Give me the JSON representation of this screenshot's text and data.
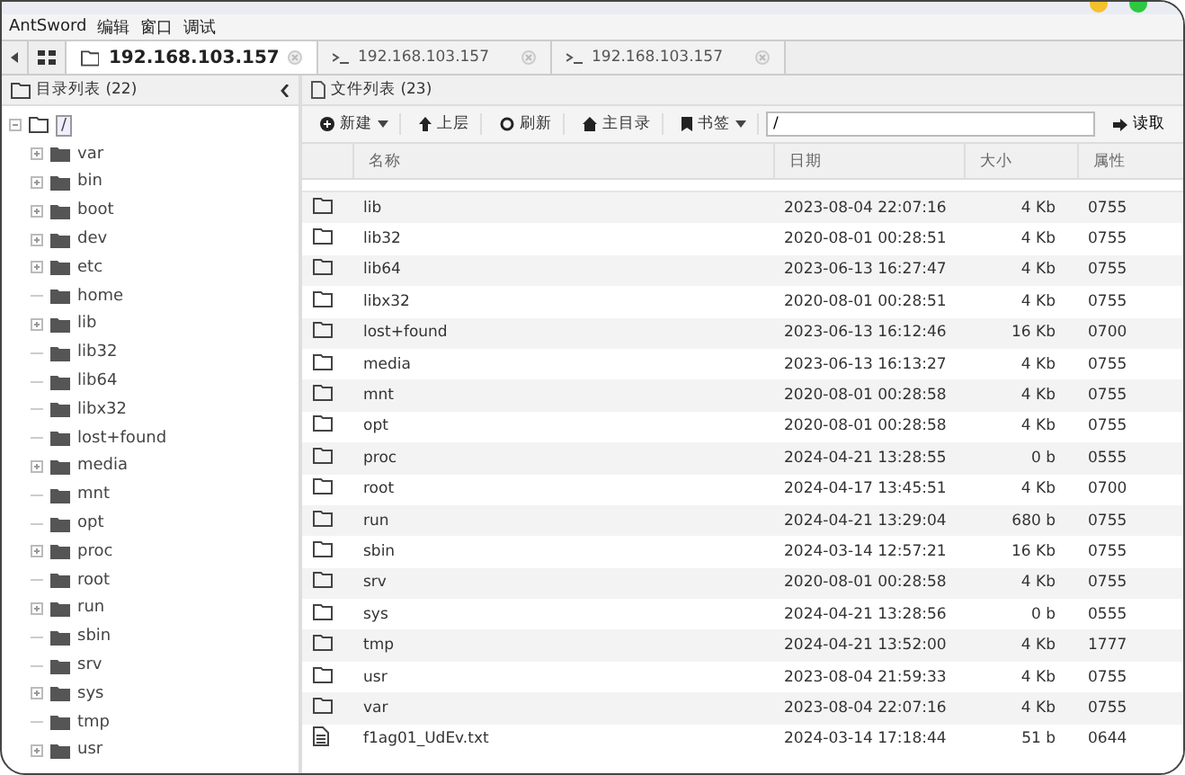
{
  "menu": [
    "AntSword",
    "编辑",
    "窗口",
    "调试"
  ],
  "tabs": [
    {
      "label": "192.168.103.157",
      "kind": "folder",
      "selected": true
    },
    {
      "label": "192.168.103.157",
      "kind": "terminal",
      "selected": false
    },
    {
      "label": "192.168.103.157",
      "kind": "terminal",
      "selected": false
    }
  ],
  "dir_panel": {
    "title": "目录列表 (22)",
    "root": {
      "name": "/",
      "selected": true
    },
    "items": [
      {
        "name": "var",
        "has_children": true
      },
      {
        "name": "bin",
        "has_children": true
      },
      {
        "name": "boot",
        "has_children": true
      },
      {
        "name": "dev",
        "has_children": true
      },
      {
        "name": "etc",
        "has_children": true
      },
      {
        "name": "home",
        "has_children": false
      },
      {
        "name": "lib",
        "has_children": true
      },
      {
        "name": "lib32",
        "has_children": false
      },
      {
        "name": "lib64",
        "has_children": false
      },
      {
        "name": "libx32",
        "has_children": false
      },
      {
        "name": "lost+found",
        "has_children": false
      },
      {
        "name": "media",
        "has_children": true
      },
      {
        "name": "mnt",
        "has_children": false
      },
      {
        "name": "opt",
        "has_children": false
      },
      {
        "name": "proc",
        "has_children": true
      },
      {
        "name": "root",
        "has_children": false
      },
      {
        "name": "run",
        "has_children": true
      },
      {
        "name": "sbin",
        "has_children": false
      },
      {
        "name": "srv",
        "has_children": false
      },
      {
        "name": "sys",
        "has_children": true
      },
      {
        "name": "tmp",
        "has_children": false
      },
      {
        "name": "usr",
        "has_children": true
      }
    ]
  },
  "file_panel": {
    "title": "文件列表 (23)",
    "toolbar": [
      {
        "label": "新建",
        "kind": "new",
        "dropdown": true
      },
      {
        "label": "上层",
        "kind": "up",
        "dropdown": false
      },
      {
        "label": "刷新",
        "kind": "refresh",
        "dropdown": false
      },
      {
        "label": "主目录",
        "kind": "home",
        "dropdown": false
      },
      {
        "label": "书签",
        "kind": "bookmark",
        "dropdown": true
      }
    ],
    "path": "/",
    "read_button": "读取",
    "columns": [
      "名称",
      "日期",
      "大小",
      "属性"
    ],
    "rows": [
      {
        "kind": "folder",
        "name": "lib",
        "date": "2023-08-04 22:07:16",
        "size": "4 Kb",
        "perm": "0755"
      },
      {
        "kind": "folder",
        "name": "lib32",
        "date": "2020-08-01 00:28:51",
        "size": "4 Kb",
        "perm": "0755"
      },
      {
        "kind": "folder",
        "name": "lib64",
        "date": "2023-06-13 16:27:47",
        "size": "4 Kb",
        "perm": "0755"
      },
      {
        "kind": "folder",
        "name": "libx32",
        "date": "2020-08-01 00:28:51",
        "size": "4 Kb",
        "perm": "0755"
      },
      {
        "kind": "folder",
        "name": "lost+found",
        "date": "2023-06-13 16:12:46",
        "size": "16 Kb",
        "perm": "0700"
      },
      {
        "kind": "folder",
        "name": "media",
        "date": "2023-06-13 16:13:27",
        "size": "4 Kb",
        "perm": "0755"
      },
      {
        "kind": "folder",
        "name": "mnt",
        "date": "2020-08-01 00:28:58",
        "size": "4 Kb",
        "perm": "0755"
      },
      {
        "kind": "folder",
        "name": "opt",
        "date": "2020-08-01 00:28:58",
        "size": "4 Kb",
        "perm": "0755"
      },
      {
        "kind": "folder",
        "name": "proc",
        "date": "2024-04-21 13:28:55",
        "size": "0 b",
        "perm": "0555"
      },
      {
        "kind": "folder",
        "name": "root",
        "date": "2024-04-17 13:45:51",
        "size": "4 Kb",
        "perm": "0700"
      },
      {
        "kind": "folder",
        "name": "run",
        "date": "2024-04-21 13:29:04",
        "size": "680 b",
        "perm": "0755"
      },
      {
        "kind": "folder",
        "name": "sbin",
        "date": "2024-03-14 12:57:21",
        "size": "16 Kb",
        "perm": "0755"
      },
      {
        "kind": "folder",
        "name": "srv",
        "date": "2020-08-01 00:28:58",
        "size": "4 Kb",
        "perm": "0755"
      },
      {
        "kind": "folder",
        "name": "sys",
        "date": "2024-04-21 13:28:56",
        "size": "0 b",
        "perm": "0555"
      },
      {
        "kind": "folder",
        "name": "tmp",
        "date": "2024-04-21 13:52:00",
        "size": "4 Kb",
        "perm": "1777"
      },
      {
        "kind": "folder",
        "name": "usr",
        "date": "2023-08-04 21:59:33",
        "size": "4 Kb",
        "perm": "0755"
      },
      {
        "kind": "folder",
        "name": "var",
        "date": "2023-08-04 22:07:16",
        "size": "4 Kb",
        "perm": "0755"
      },
      {
        "kind": "file",
        "name": "f1ag01_UdEv.txt",
        "date": "2024-03-14 17:18:44",
        "size": "51 b",
        "perm": "0644"
      }
    ]
  }
}
